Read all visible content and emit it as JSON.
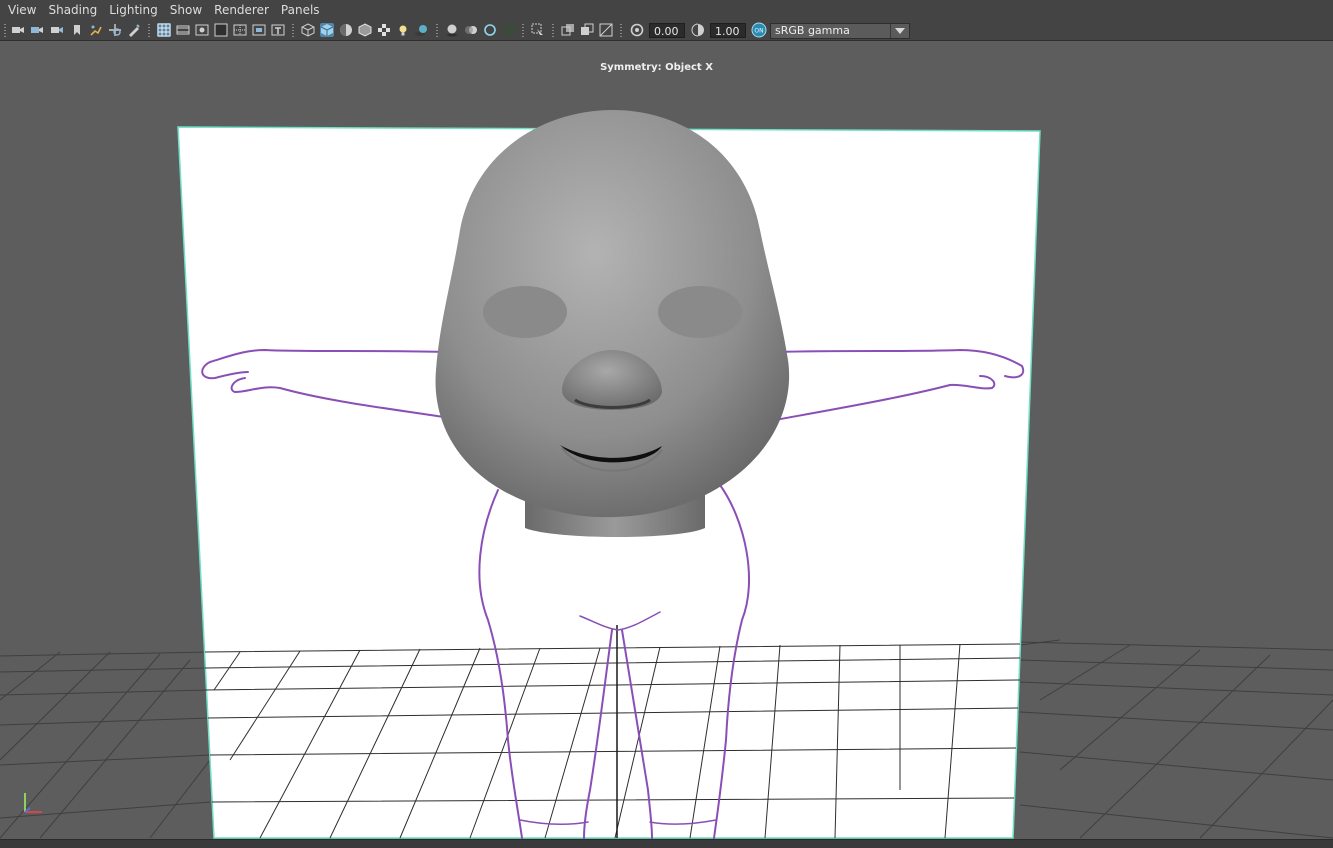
{
  "menus": [
    "View",
    "Shading",
    "Lighting",
    "Show",
    "Renderer",
    "Panels"
  ],
  "toolbar": {
    "exposure": "0.00",
    "gamma": "1.00",
    "color_space": "sRGB gamma",
    "icons": [
      "camera-select-icon",
      "camera-attributes-icon",
      "camera-bookmark-icon",
      "image-plane-icon",
      "bookmark-icon",
      "grease-pencil-icon",
      "2d-pan-zoom-icon",
      "grid-icon",
      "film-gate-icon",
      "resolution-gate-icon",
      "gate-mask-icon",
      "field-chart-icon",
      "safe-action-icon",
      "safe-title-icon",
      "wireframe-icon",
      "smooth-shade-icon",
      "default-material-icon",
      "wireframe-on-shaded-icon",
      "textured-icon",
      "use-lights-icon",
      "shadows-icon",
      "screen-space-ao-icon",
      "motion-blur-icon",
      "multisample-aa-icon",
      "depth-of-field-icon",
      "isolate-select-icon",
      "xray-icon",
      "xray-joints-icon",
      "xray-components-icon",
      "backface-culling-icon",
      "exposure-icon",
      "gamma-icon",
      "color-management-icon"
    ]
  },
  "viewport": {
    "symmetry_label": "Symmetry: Object X",
    "axis_icon": "axis-indicator-icon",
    "colors": {
      "background": "#5d5d5d",
      "image_plane": "#ffffff",
      "plane_outline": "#6fe0c3",
      "sketch": "#8a4fb6",
      "head": "#9a9a9a"
    }
  }
}
